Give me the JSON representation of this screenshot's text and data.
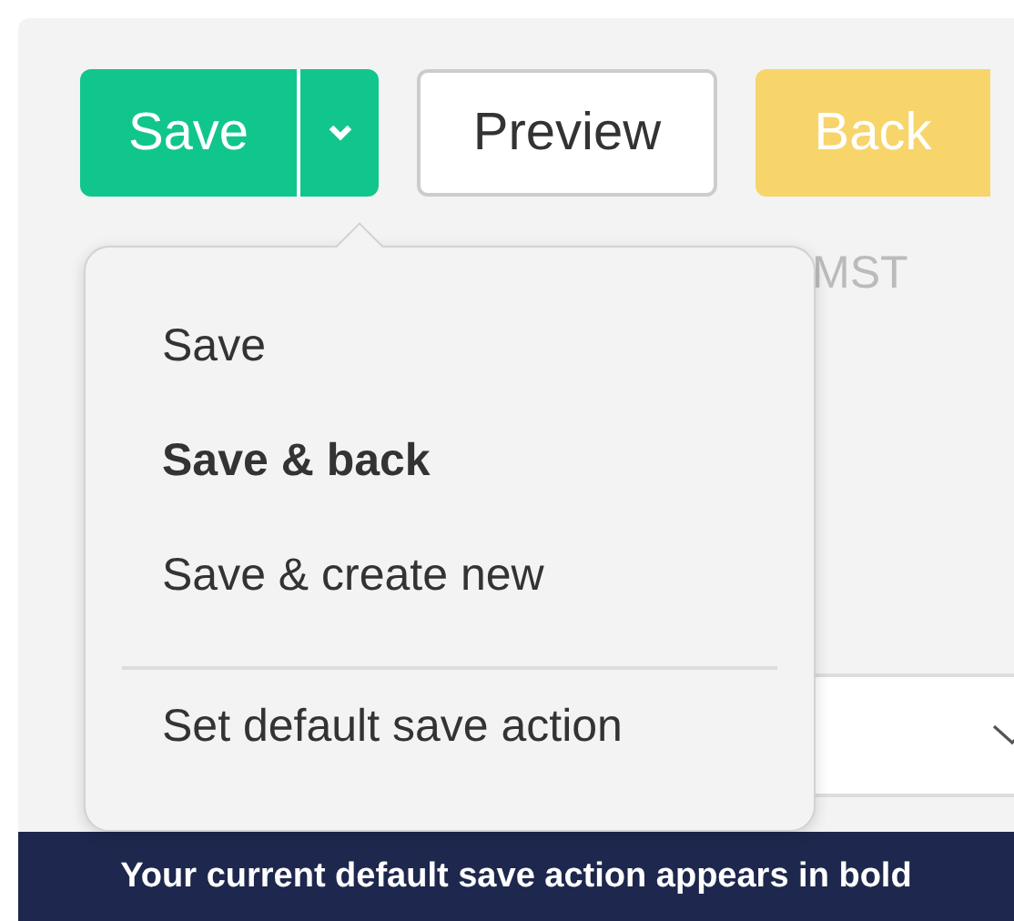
{
  "toolbar": {
    "save_button": {
      "label": "Save"
    },
    "preview_button": {
      "label": "Preview"
    },
    "back_button": {
      "label": "Back"
    }
  },
  "form": {
    "field_label": "MST"
  },
  "save_menu": {
    "items": [
      {
        "label": "Save",
        "kind": "action",
        "is_default": false
      },
      {
        "label": "Save & back",
        "kind": "action",
        "is_default": true
      },
      {
        "label": "Save & create new",
        "kind": "action",
        "is_default": false
      },
      {
        "label": "Set default save action",
        "kind": "setting",
        "is_default": false
      }
    ]
  },
  "banner": {
    "text": "Your current default save action appears in bold"
  }
}
